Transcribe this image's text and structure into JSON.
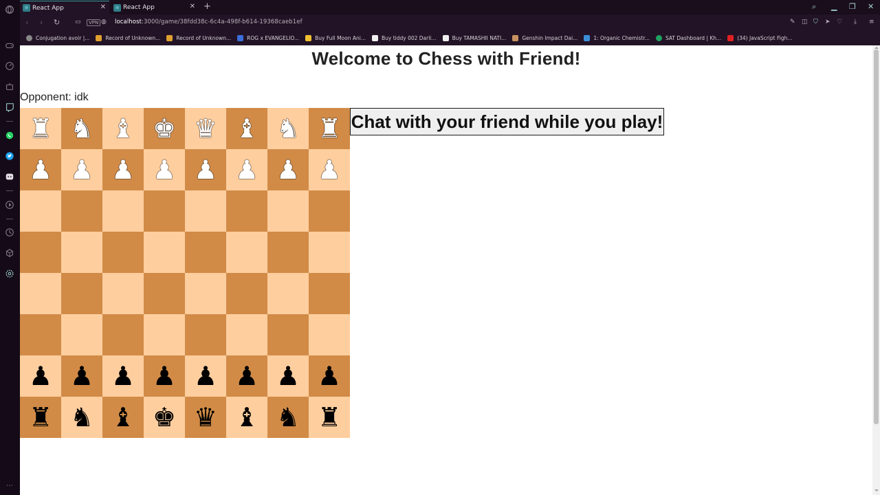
{
  "browser": {
    "tabs": [
      {
        "label": "React App",
        "active": true
      },
      {
        "label": "React App",
        "active": false
      }
    ],
    "url_host": "localhost",
    "url_path": ":3000/game/38fdd38c-6c4a-498f-b614-19368caeb1ef",
    "vpn_label": "VPN",
    "bookmarks": [
      {
        "label": "Conjugation avoir |...",
        "color": "#888888"
      },
      {
        "label": "Record of Unknown...",
        "color": "#e0a030"
      },
      {
        "label": "Record of Unknown...",
        "color": "#e0a030"
      },
      {
        "label": "ROG x EVANGELIO...",
        "color": "#3a6fd8"
      },
      {
        "label": "Buy Full Moon Ani...",
        "color": "#f0c030"
      },
      {
        "label": "Buy tiddy 002 Darli...",
        "color": "#f0f0f0"
      },
      {
        "label": "Buy TAMASHII NATI...",
        "color": "#f0f0f0"
      },
      {
        "label": "Genshin Impact Dai...",
        "color": "#c89060"
      },
      {
        "label": "1: Organic Chemistr...",
        "color": "#3a8fd8"
      },
      {
        "label": "SAT Dashboard | Kh...",
        "color": "#1fa060"
      },
      {
        "label": "(34) JavaScript Figh...",
        "color": "#e02020"
      }
    ]
  },
  "page": {
    "title": "Welcome to Chess with Friend!",
    "opponent": "Opponent: idk",
    "chat_heading": "Chat with your friend while you play!"
  },
  "board": {
    "rows": [
      [
        "♖",
        "♘",
        "♗",
        "♔",
        "♕",
        "♗",
        "♘",
        "♖"
      ],
      [
        "♙",
        "♙",
        "♙",
        "♙",
        "♙",
        "♙",
        "♙",
        "♙"
      ],
      [
        "",
        "",
        "",
        "",
        "",
        "",
        "",
        ""
      ],
      [
        "",
        "",
        "",
        "",
        "",
        "",
        "",
        ""
      ],
      [
        "",
        "",
        "",
        "",
        "",
        "",
        "",
        ""
      ],
      [
        "",
        "",
        "",
        "",
        "",
        "",
        "",
        ""
      ],
      [
        "♟",
        "♟",
        "♟",
        "♟",
        "♟",
        "♟",
        "♟",
        "♟"
      ],
      [
        "♜",
        "♞",
        "♝",
        "♚",
        "♛",
        "♝",
        "♞",
        "♜"
      ]
    ],
    "colors": {
      "light": "#ffce9e",
      "dark": "#d18b47"
    }
  }
}
